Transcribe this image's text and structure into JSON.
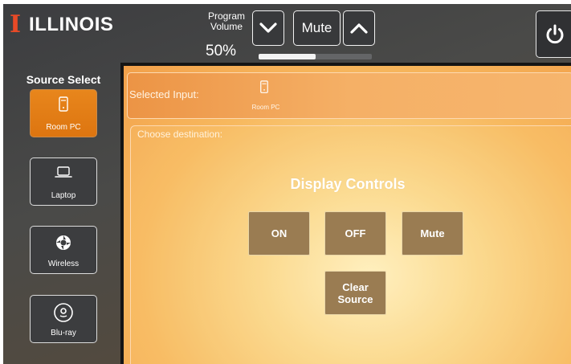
{
  "header": {
    "logo_mark": "I",
    "logo_text": "ILLINOIS",
    "volume_label": "Program Volume",
    "volume_percent_text": "50%",
    "volume_level": 0.5,
    "mute_label": "Mute"
  },
  "sidebar": {
    "title": "Source Select",
    "sources": [
      {
        "label": "Room PC",
        "icon": "room-pc-icon",
        "active": true
      },
      {
        "label": "Laptop",
        "icon": "laptop-icon",
        "active": false
      },
      {
        "label": "Wireless",
        "icon": "wireless-icon",
        "active": false
      },
      {
        "label": "Blu-ray",
        "icon": "bluray-disc-icon",
        "active": false
      }
    ]
  },
  "main": {
    "selected_input_label": "Selected Input:",
    "selected_input_value": "Room PC",
    "choose_destination_label": "Choose destination:",
    "display_controls_title": "Display Controls",
    "buttons": {
      "on": "ON",
      "off": "OFF",
      "mute": "Mute",
      "clear_source": "Clear Source"
    }
  },
  "colors": {
    "brand_orange": "#e84a27",
    "active_source": "#e07a14",
    "control_button": "#9a7c52"
  }
}
